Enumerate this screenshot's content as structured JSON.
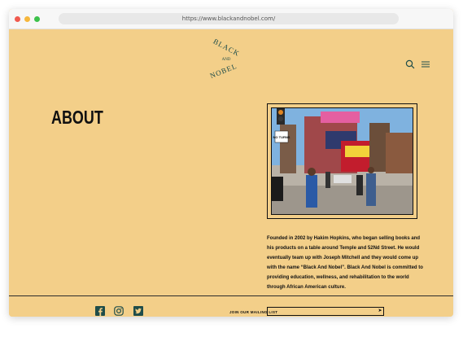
{
  "browser": {
    "url": "https://www.blackandnobel.com/"
  },
  "header": {
    "logo_text_top": "BLACK",
    "logo_text_middle": "AND",
    "logo_text_bottom": "NOBEL",
    "icons": [
      "search-icon",
      "menu-icon"
    ]
  },
  "main": {
    "title": "ABOUT",
    "photo_sign": "NO TURNS",
    "description": "Founded in 2002 by Hakim Hopkins, who began selling books and his products on a table around Temple and 52Nd Street. He would eventually team up with Joseph Mitchell and they would come up with the name “Black And Nobel”. Black And Nobel is committed to providing education, wellness, and rehabilitation to the world through African American culture."
  },
  "footer": {
    "social": [
      "facebook-icon",
      "instagram-icon",
      "twitter-icon"
    ],
    "mailing_label": "JOIN OUR MAILING LIST",
    "mailing_placeholder": "",
    "submit_glyph": "➤"
  },
  "colors": {
    "background": "#f3cf89",
    "accent": "#1f4d4a",
    "text": "#111111"
  }
}
